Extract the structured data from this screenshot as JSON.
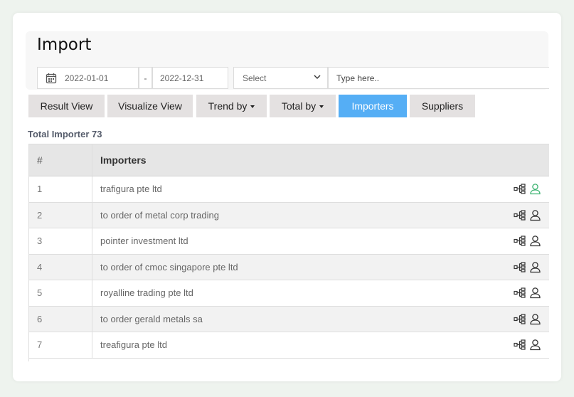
{
  "page": {
    "title": "Import"
  },
  "filters": {
    "date_from": "2022-01-01",
    "date_separator": "-",
    "date_to": "2022-12-31",
    "select_value": "Select",
    "search_placeholder": "Type here.."
  },
  "tabs": [
    {
      "label": "Result View",
      "active": false
    },
    {
      "label": "Visualize View",
      "active": false
    },
    {
      "label": "Trend by",
      "active": false,
      "dropdown": true
    },
    {
      "label": "Total by",
      "active": false,
      "dropdown": true
    },
    {
      "label": "Importers",
      "active": true
    },
    {
      "label": "Suppliers",
      "active": false
    }
  ],
  "summary": {
    "total_label": "Total Importer 73"
  },
  "table": {
    "columns": [
      "#",
      "Importers"
    ],
    "rows": [
      {
        "num": "1",
        "name": "trafigura pte ltd",
        "user_icon_color": "#3cb371"
      },
      {
        "num": "2",
        "name": "to order of metal corp trading",
        "user_icon_color": "#333333"
      },
      {
        "num": "3",
        "name": "pointer investment ltd",
        "user_icon_color": "#333333"
      },
      {
        "num": "4",
        "name": "to order of cmoc singapore pte ltd",
        "user_icon_color": "#333333"
      },
      {
        "num": "5",
        "name": "royalline trading pte ltd",
        "user_icon_color": "#333333"
      },
      {
        "num": "6",
        "name": "to order gerald metals sa",
        "user_icon_color": "#333333"
      },
      {
        "num": "7",
        "name": "treafigura pte ltd",
        "user_icon_color": "#333333"
      }
    ]
  },
  "icons": {
    "calendar": "calendar-icon",
    "dropdown": "chevron-down-icon",
    "hierarchy": "hierarchy-icon",
    "user": "user-icon"
  },
  "colors": {
    "accent": "#55aef5",
    "tab_bg": "#e4e1e1",
    "active_user": "#3cb371"
  }
}
